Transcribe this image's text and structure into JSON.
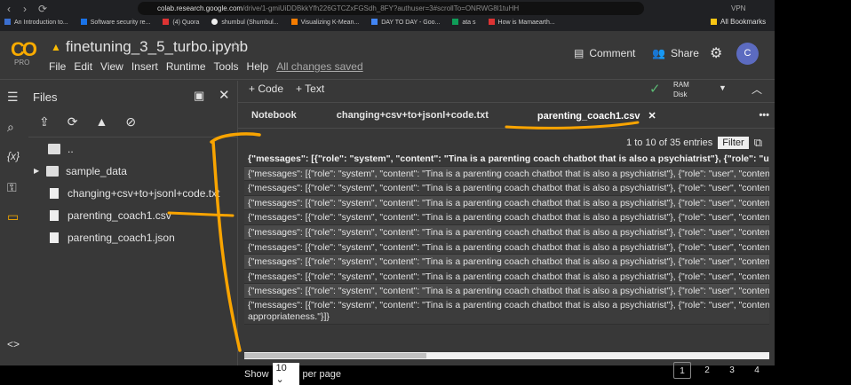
{
  "browser": {
    "url_host": "colab.research.google.com",
    "url_path": "/drive/1-gmiUiDDBkkYfh226GTCZxFGSdh_8FY?authuser=3#scrollTo=ONRWG8l1tuHH",
    "vpn": "VPN",
    "bookmarks": [
      "An Introduction to...",
      "Software security re...",
      "(4) Quora",
      "shumbul (Shumbul...",
      "Visualizing K-Mean...",
      "DAY TO DAY - Goo...",
      "ata s",
      "How is Mamaearth..."
    ],
    "all_bookmarks": "All Bookmarks"
  },
  "header": {
    "logo": "CO",
    "pro": "PRO",
    "title": "finetuning_3_5_turbo.ipynb",
    "menu": [
      "File",
      "Edit",
      "View",
      "Insert",
      "Runtime",
      "Tools",
      "Help"
    ],
    "saved": "All changes saved",
    "comment": "Comment",
    "share": "Share",
    "avatar": "C"
  },
  "files": {
    "title": "Files",
    "items": [
      "..",
      "sample_data",
      "changing+csv+to+jsonl+code.txt",
      "parenting_coach1.csv",
      "parenting_coach1.json"
    ]
  },
  "toolbar": {
    "code": "+ Code",
    "text": "+ Text",
    "ram": "RAM",
    "disk": "Disk"
  },
  "tabs": [
    "Notebook",
    "changing+csv+to+jsonl+code.txt",
    "parenting_coach1.csv"
  ],
  "table": {
    "entries": "1 to 10 of 35 entries",
    "filter": "Filter",
    "header": "{\"messages\": [{\"role\": \"system\", \"content\": \"Tina is a parenting coach chatbot that is also a psychiatrist\"}, {\"role\": \"user\"",
    "row": "{\"messages\": [{\"role\": \"system\", \"content\": \"Tina is a parenting coach chatbot that is also a psychiatrist\"}, {\"role\": \"user\", \"content\"",
    "last_line2": "appropriateness.\"}]}",
    "show": "Show",
    "per_page_value": "10",
    "per_page": "per page",
    "pages": [
      "1",
      "2",
      "3",
      "4"
    ]
  }
}
